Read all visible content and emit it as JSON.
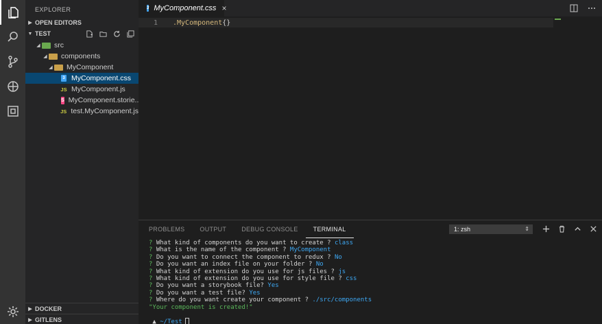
{
  "sidebar": {
    "title": "EXPLORER",
    "open_editors": "OPEN EDITORS",
    "project": "TEST",
    "tree": [
      {
        "label": "src",
        "type": "folder-green",
        "depth": 0
      },
      {
        "label": "components",
        "type": "folder-yellow",
        "depth": 1
      },
      {
        "label": "MyComponent",
        "type": "folder-yellow",
        "depth": 2
      },
      {
        "label": "MyComponent.css",
        "type": "css",
        "depth": 3,
        "selected": true
      },
      {
        "label": "MyComponent.js",
        "type": "js",
        "depth": 3
      },
      {
        "label": "MyComponent.storie...",
        "type": "storybook",
        "depth": 3
      },
      {
        "label": "test.MyComponent.js",
        "type": "js",
        "depth": 3
      }
    ],
    "docker": "DOCKER",
    "gitlens": "GITLENS"
  },
  "editor": {
    "tab_label": "MyComponent.css",
    "line_number": "1",
    "code_selector": ".MyComponent",
    "code_braces": "{}"
  },
  "panel": {
    "tabs": [
      "PROBLEMS",
      "OUTPUT",
      "DEBUG CONSOLE",
      "TERMINAL"
    ],
    "active_tab": "TERMINAL",
    "terminal_select": "1: zsh",
    "terminal_lines": [
      {
        "q": "? What kind of components do you want to create ?",
        "a": "class"
      },
      {
        "q": "? What is the name of the component ?",
        "a": "MyComponent"
      },
      {
        "q": "? Do you want to connect the component to redux ?",
        "a": "No"
      },
      {
        "q": "? Do you want an index file on your folder ?",
        "a": "No"
      },
      {
        "q": "? What kind of extension do you use for js files ?",
        "a": "js"
      },
      {
        "q": "? What kind of extension do you use for style file ?",
        "a": "css"
      },
      {
        "q": "? Do you want a storybook file?",
        "a": "Yes"
      },
      {
        "q": "? Do you want a test file?",
        "a": "Yes"
      },
      {
        "q": "? Where do you want create your component ?",
        "a": "./src/components"
      }
    ],
    "result": "\"Your component is created!\"",
    "prompt_symbol": "▲",
    "prompt_path": "~/Test"
  },
  "colors": {
    "accent_selected": "#094771",
    "terminal_answer": "#3ea9f5",
    "terminal_question_mark": "#5bb85b"
  }
}
